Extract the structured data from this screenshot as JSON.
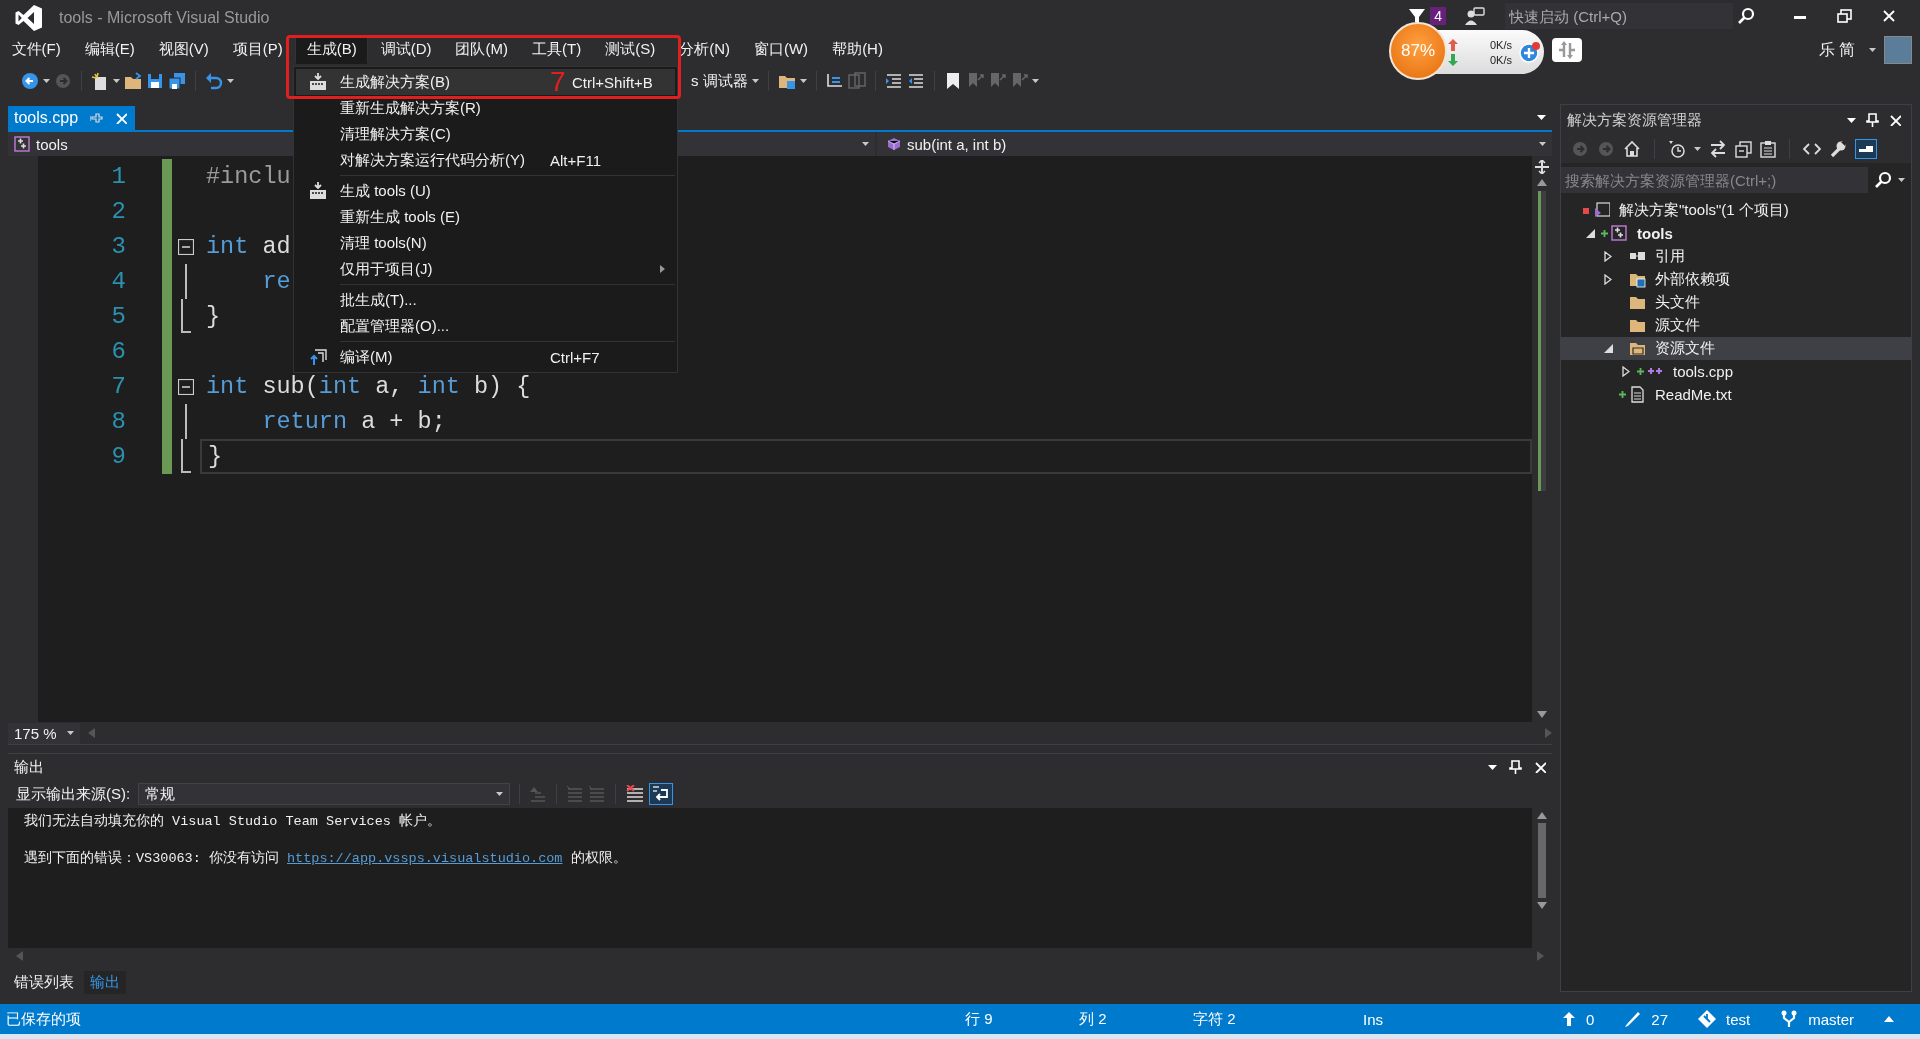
{
  "window": {
    "title": "tools - Microsoft Visual Studio"
  },
  "title_bar": {
    "notification_count": "4",
    "quick_launch": {
      "placeholder": "快速启动 (Ctrl+Q)"
    }
  },
  "menu_bar": [
    {
      "label": "文件(F)",
      "selected": false
    },
    {
      "label": "编辑(E)",
      "selected": false
    },
    {
      "label": "视图(V)",
      "selected": false
    },
    {
      "label": "项目(P)",
      "selected": false
    },
    {
      "label": "生成(B)",
      "selected": true
    },
    {
      "label": "调试(D)",
      "selected": false
    },
    {
      "label": "团队(M)",
      "selected": false
    },
    {
      "label": "工具(T)",
      "selected": false
    },
    {
      "label": "测试(S)",
      "selected": false
    },
    {
      "label": "分析(N)",
      "selected": false
    },
    {
      "label": "窗口(W)",
      "selected": false
    },
    {
      "label": "帮助(H)",
      "selected": false
    }
  ],
  "account": {
    "name": "乐 简"
  },
  "toolbar": {
    "debugger_label": "s 调试器"
  },
  "network_widget": {
    "percent": "87%",
    "upload": "0K/s",
    "download": "0K/s"
  },
  "build_menu": [
    {
      "kind": "build-item",
      "label": "生成解决方案(B)",
      "shortcut": "Ctrl+Shift+B",
      "selected": true
    },
    {
      "kind": "item",
      "label": "重新生成解决方案(R)",
      "selected": false
    },
    {
      "kind": "item",
      "label": "清理解决方案(C)",
      "selected": false
    },
    {
      "kind": "item",
      "label": "对解决方案运行代码分析(Y)",
      "shortcut": "Alt+F11",
      "selected": false
    },
    {
      "kind": "separator"
    },
    {
      "kind": "build-item",
      "label": "生成 tools (U)",
      "selected": false
    },
    {
      "kind": "item",
      "label": "重新生成 tools (E)",
      "selected": false
    },
    {
      "kind": "item",
      "label": "清理 tools(N)",
      "selected": false
    },
    {
      "kind": "submenu",
      "label": "仅用于项目(J)",
      "selected": false
    },
    {
      "kind": "separator"
    },
    {
      "kind": "item",
      "label": "批生成(T)...",
      "selected": false
    },
    {
      "kind": "item",
      "label": "配置管理器(O)...",
      "selected": false
    },
    {
      "kind": "separator"
    },
    {
      "kind": "compile-item",
      "label": "编译(M)",
      "shortcut": "Ctrl+F7",
      "selected": false
    }
  ],
  "annotation": {
    "label": "7"
  },
  "document_tabs": [
    {
      "label": "tools.cpp",
      "selected": true
    }
  ],
  "nav_bar": {
    "project": "tools",
    "member": "sub(int a, int b)"
  },
  "editor": {
    "lines": [
      {
        "number": "1",
        "kind": "plain",
        "changed": true,
        "current": false,
        "tokens": [
          {
            "kind": "preprocessor",
            "text": "#inclu"
          }
        ]
      },
      {
        "number": "2",
        "kind": "plain",
        "changed": true,
        "current": false
      },
      {
        "number": "3",
        "kind": "fold-start",
        "changed": true,
        "current": false,
        "tokens": [
          {
            "kind": "keyword",
            "text": "int"
          },
          {
            "kind": "plain",
            "text": " ad"
          }
        ]
      },
      {
        "number": "4",
        "kind": "fold-body",
        "changed": true,
        "current": false,
        "tokens": [
          {
            "kind": "keyword",
            "text": "    re"
          }
        ]
      },
      {
        "number": "5",
        "kind": "fold-end",
        "changed": true,
        "current": false,
        "tokens": [
          {
            "kind": "plain",
            "text": "}"
          }
        ]
      },
      {
        "number": "6",
        "kind": "plain",
        "changed": true,
        "current": false
      },
      {
        "number": "7",
        "kind": "fold-start",
        "changed": true,
        "current": false,
        "tokens": [
          {
            "kind": "keyword",
            "text": "int"
          },
          {
            "kind": "plain",
            "text": " sub("
          },
          {
            "kind": "keyword",
            "text": "int"
          },
          {
            "kind": "plain",
            "text": " a, "
          },
          {
            "kind": "keyword",
            "text": "int"
          },
          {
            "kind": "plain",
            "text": " b) {"
          }
        ]
      },
      {
        "number": "8",
        "kind": "fold-body",
        "changed": true,
        "current": false,
        "tokens": [
          {
            "kind": "keyword",
            "text": "    return"
          },
          {
            "kind": "plain",
            "text": " a + b;"
          }
        ]
      },
      {
        "number": "9",
        "kind": "fold-end",
        "changed": true,
        "current": true,
        "tokens": [
          {
            "kind": "plain",
            "text": "}"
          }
        ]
      }
    ],
    "zoom": "175 %"
  },
  "output": {
    "title": "输出",
    "source_label": "显示输出来源(S):",
    "source": "常规",
    "lines": [
      {
        "segments": [
          {
            "kind": "text",
            "text": "我们无法自动填充你的 Visual Studio Team Services 帐户。"
          }
        ]
      },
      {
        "segments": [
          {
            "kind": "text",
            "text": "遇到下面的错误：VS30063: 你没有访问 "
          },
          {
            "kind": "link",
            "text": "https://app.vssps.visualstudio.com"
          },
          {
            "kind": "text",
            "text": " 的权限。"
          }
        ]
      }
    ]
  },
  "bottom_tabs": [
    {
      "label": "错误列表",
      "selected": false
    },
    {
      "label": "输出",
      "selected": true
    }
  ],
  "solution_explorer": {
    "title": "解决方案资源管理器",
    "search": {
      "placeholder": "搜索解决方案资源管理器(Ctrl+;)"
    },
    "tree": [
      {
        "label": "解决方案\"tools\"(1 个项目)",
        "kind": "solution",
        "color": "#e5484d",
        "selected": false,
        "children": [
          {
            "label": "tools",
            "kind": "project",
            "expanded": true,
            "color": "#5cb85c",
            "selected": false,
            "children": [
              {
                "label": "引用",
                "kind": "references",
                "expanded": false,
                "selected": false
              },
              {
                "label": "外部依赖项",
                "kind": "external",
                "expanded": false,
                "selected": false
              },
              {
                "label": "头文件",
                "kind": "folder",
                "selected": false
              },
              {
                "label": "源文件",
                "kind": "folder",
                "selected": false
              },
              {
                "label": "资源文件",
                "kind": "folder-open",
                "expanded": true,
                "selected": true,
                "children": [
                  {
                    "label": "tools.cpp",
                    "kind": "cpp",
                    "expanded": false,
                    "color": "#5cb85c",
                    "selected": false
                  }
                ]
              },
              {
                "label": "ReadMe.txt",
                "kind": "text",
                "color": "#5cb85c",
                "selected": false
              }
            ]
          }
        ]
      }
    ]
  },
  "status_bar": {
    "message": "已保存的项",
    "line": "行 9",
    "column": "列 2",
    "char": "字符 2",
    "mode": "Ins",
    "unpushed": "0",
    "changes": "27",
    "repo": "test",
    "branch": "master"
  }
}
